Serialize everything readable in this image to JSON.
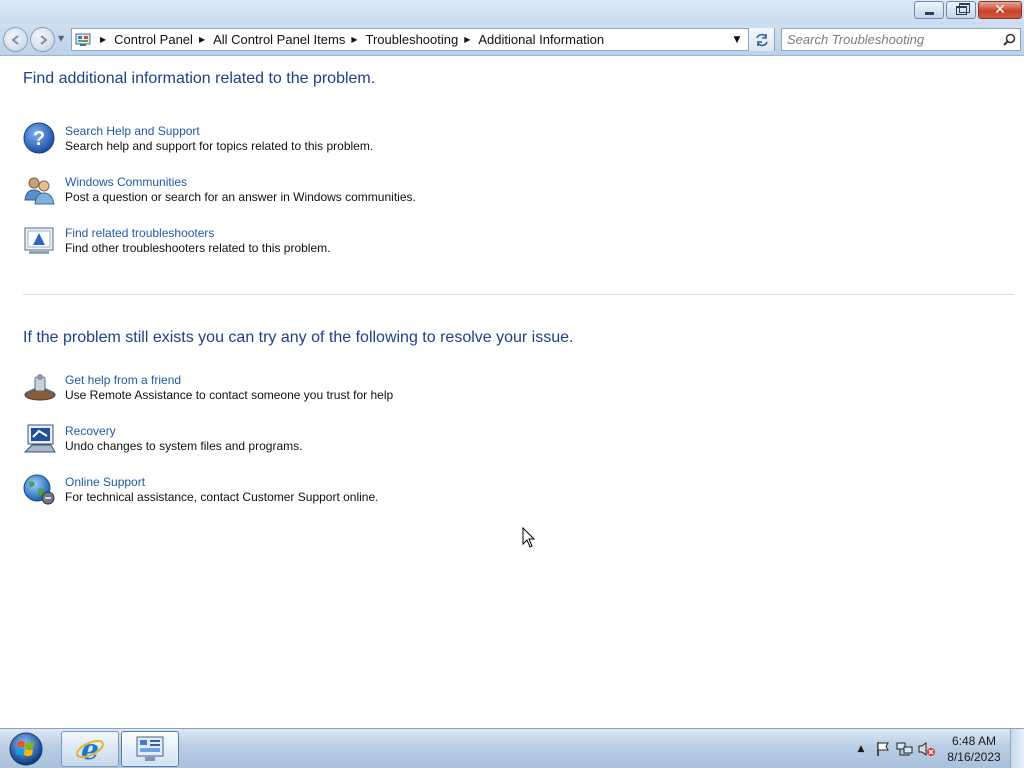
{
  "window": {
    "minimize_label": "Minimize",
    "maximize_label": "Restore",
    "close_label": "Close"
  },
  "nav": {
    "breadcrumbs": [
      {
        "label": "Control Panel"
      },
      {
        "label": "All Control Panel Items"
      },
      {
        "label": "Troubleshooting"
      },
      {
        "label": "Additional Information"
      }
    ],
    "search_placeholder": "Search Troubleshooting"
  },
  "section1": {
    "heading": "Find additional information related to the problem.",
    "items": [
      {
        "icon": "help-icon",
        "title": "Search Help and Support",
        "desc": "Search help and support for topics related to this problem."
      },
      {
        "icon": "communities-icon",
        "title": "Windows Communities",
        "desc": "Post a question or search for an answer in Windows communities."
      },
      {
        "icon": "troubleshooter-icon",
        "title": "Find related troubleshooters",
        "desc": "Find other troubleshooters related to this problem."
      }
    ]
  },
  "section2": {
    "heading": "If the problem still exists you can try any of the following to resolve your issue.",
    "items": [
      {
        "icon": "remote-assistance-icon",
        "title": "Get help from a friend",
        "desc": "Use Remote Assistance to contact someone you trust for help"
      },
      {
        "icon": "recovery-icon",
        "title": "Recovery",
        "desc": "Undo changes to system files and programs."
      },
      {
        "icon": "online-support-icon",
        "title": "Online Support",
        "desc": "For technical assistance, contact Customer Support online."
      }
    ]
  },
  "taskbar": {
    "time": "6:48 AM",
    "date": "8/16/2023"
  },
  "colors": {
    "heading": "#1e3f8c",
    "link": "#1f5aa6",
    "close_button": "#c7432b"
  }
}
